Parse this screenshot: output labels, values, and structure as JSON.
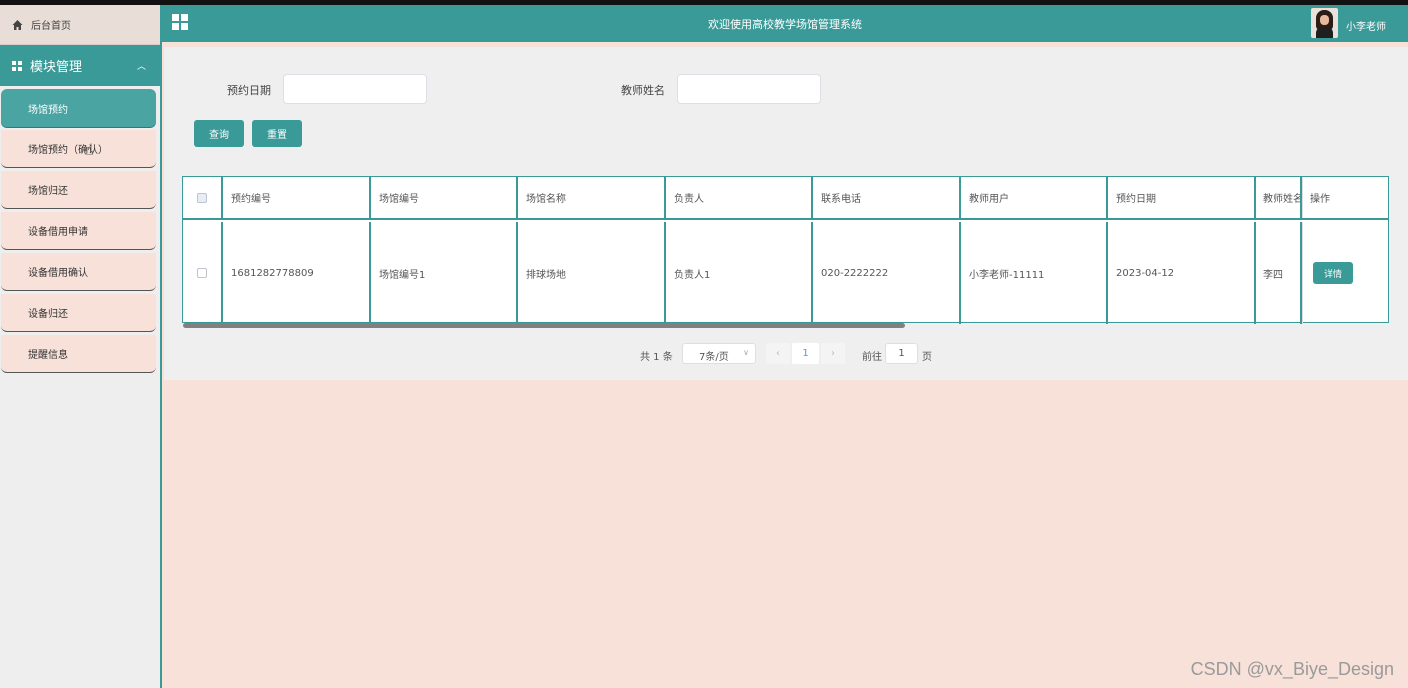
{
  "sidebar": {
    "home_label": "后台首页",
    "module_label": "模块管理",
    "items": [
      {
        "label": "场馆预约"
      },
      {
        "label": "场馆预约（确认）"
      },
      {
        "label": "场馆归还"
      },
      {
        "label": "设备借用申请"
      },
      {
        "label": "设备借用确认"
      },
      {
        "label": "设备归还"
      },
      {
        "label": "提醒信息"
      }
    ]
  },
  "header": {
    "title": "欢迎使用高校教学场馆管理系统",
    "username": "小李老师"
  },
  "search": {
    "date_label": "预约日期",
    "date_value": "",
    "teacher_label": "教师姓名",
    "teacher_value": "",
    "query_button": "查询",
    "reset_button": "重置"
  },
  "table": {
    "columns": [
      "预约编号",
      "场馆编号",
      "场馆名称",
      "负责人",
      "联系电话",
      "教师用户",
      "预约日期",
      "教师姓名",
      "操作"
    ],
    "rows": [
      {
        "booking_no": "1681282778809",
        "venue_no": "场馆编号1",
        "venue_name": "排球场地",
        "manager": "负责人1",
        "phone": "020-2222222",
        "teacher_user": "小李老师-11111",
        "date": "2023-04-12",
        "teacher_name": "李四",
        "action": "详情"
      }
    ]
  },
  "pagination": {
    "total_text": "共 1 条",
    "page_size": "7条/页",
    "current_page": "1",
    "goto_label": "前往",
    "goto_value": "1",
    "page_suffix": "页"
  },
  "watermark": "CSDN @vx_Biye_Design",
  "colors": {
    "accent": "#3a9a98",
    "background": "#f7e1d9",
    "panel": "#efefef"
  }
}
